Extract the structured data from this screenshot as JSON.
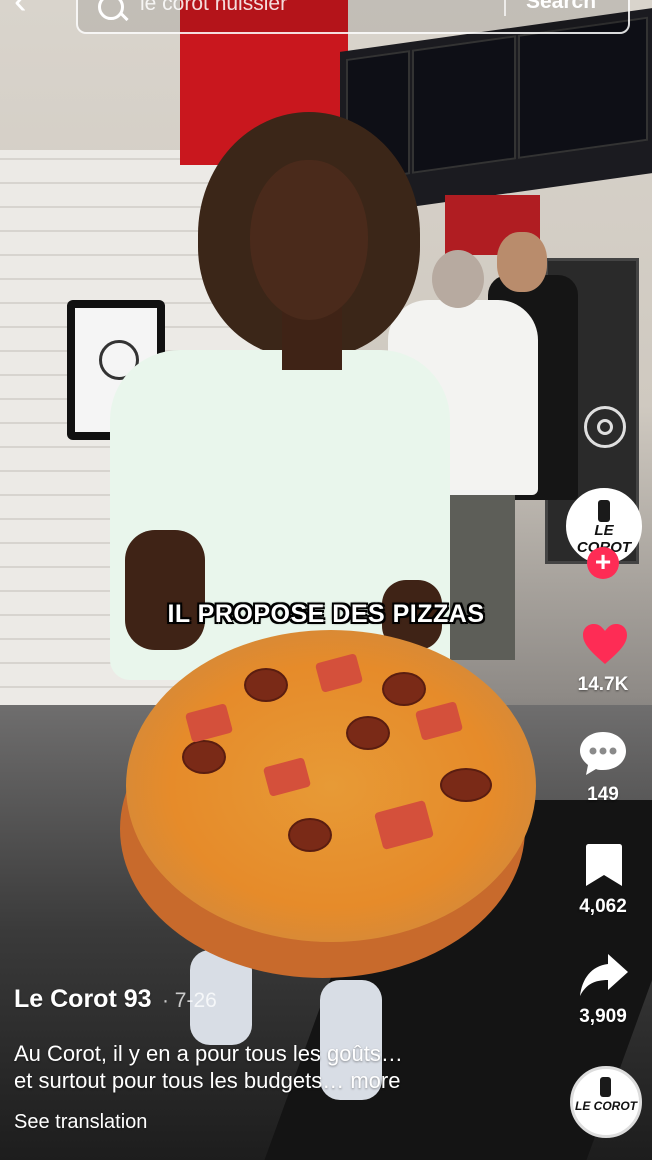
{
  "search": {
    "query": "le corot huissier",
    "button_label": "Search"
  },
  "video": {
    "caption_overlay": "IL PROPOSE DES PIZZAS"
  },
  "creator": {
    "avatar_label": "LE COROT",
    "name": "Le Corot 93",
    "date": "· 7-26"
  },
  "post": {
    "description_line1": "Au Corot, il y en a pour tous les goûts…",
    "description_line2": "et surtout pour tous les budgets…",
    "more_label": "more",
    "see_translation": "See translation"
  },
  "actions": {
    "likes": "14.7K",
    "comments": "149",
    "saves": "4,062",
    "shares": "3,909"
  },
  "sound": {
    "disc_label": "LE COROT"
  },
  "colors": {
    "like_red": "#fe2c55",
    "follow_plus": "#fe2c55"
  },
  "icons": [
    "back-arrow-icon",
    "search-icon",
    "ring-icon",
    "plus-icon",
    "heart-icon",
    "comment-icon",
    "bookmark-icon",
    "share-icon",
    "music-disc-icon"
  ]
}
